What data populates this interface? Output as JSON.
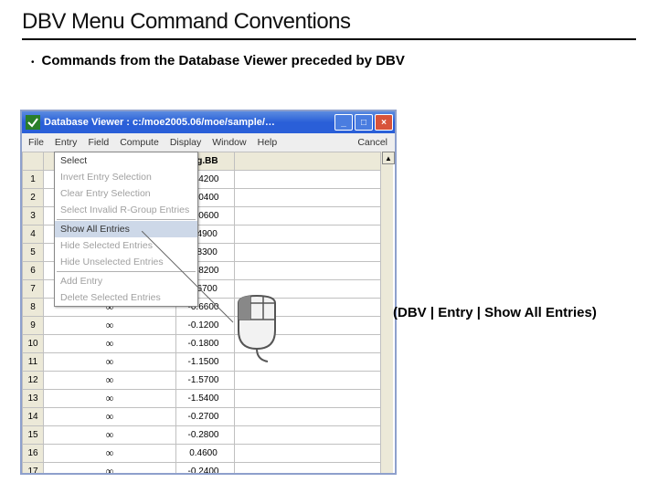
{
  "title": "DBV Menu Command Conventions",
  "bullet": "Commands from the Database Viewer preceded by DBV",
  "annotation": "(DBV | Entry | Show All Entries)",
  "window": {
    "title": "Database Viewer : c:/moe2005.06/moe/sample/…",
    "menubar": [
      "File",
      "Entry",
      "Field",
      "Compute",
      "Display",
      "Window",
      "Help"
    ],
    "cancel_label": "Cancel",
    "header_col2_visible": "log.BB",
    "dropdown": {
      "items": [
        {
          "label": "Select",
          "enabled": true
        },
        {
          "label": "Invert Entry Selection",
          "enabled": false
        },
        {
          "label": "Clear Entry Selection",
          "enabled": false
        },
        {
          "label": "Select Invalid R-Group Entries",
          "enabled": false
        }
      ],
      "items2": [
        {
          "label": "Show All Entries",
          "enabled": true,
          "hover": true
        },
        {
          "label": "Hide Selected Entries",
          "enabled": false
        },
        {
          "label": "Hide Unselected Entries",
          "enabled": false
        }
      ],
      "items3": [
        {
          "label": "Add Entry",
          "enabled": false
        },
        {
          "label": "Delete Selected Entries",
          "enabled": false
        }
      ]
    },
    "rows": [
      {
        "n": "1",
        "val": "-1.4200"
      },
      {
        "n": "2",
        "val": "-0.0400"
      },
      {
        "n": "3",
        "val": "-1.0600"
      },
      {
        "n": "4",
        "val": "0.4900"
      },
      {
        "n": "5",
        "val": "0.8300"
      },
      {
        "n": "6",
        "val": "-0.8200"
      },
      {
        "n": "7",
        "val": "0.6700"
      },
      {
        "n": "8",
        "val": "-0.6600"
      },
      {
        "n": "9",
        "val": "-0.1200"
      },
      {
        "n": "10",
        "val": "-0.1800"
      },
      {
        "n": "11",
        "val": "-1.1500"
      },
      {
        "n": "12",
        "val": "-1.5700"
      },
      {
        "n": "13",
        "val": "-1.5400"
      },
      {
        "n": "14",
        "val": "-0.2700"
      },
      {
        "n": "15",
        "val": "-0.2800"
      },
      {
        "n": "16",
        "val": "0.4600"
      },
      {
        "n": "17",
        "val": "-0.2400"
      }
    ]
  }
}
